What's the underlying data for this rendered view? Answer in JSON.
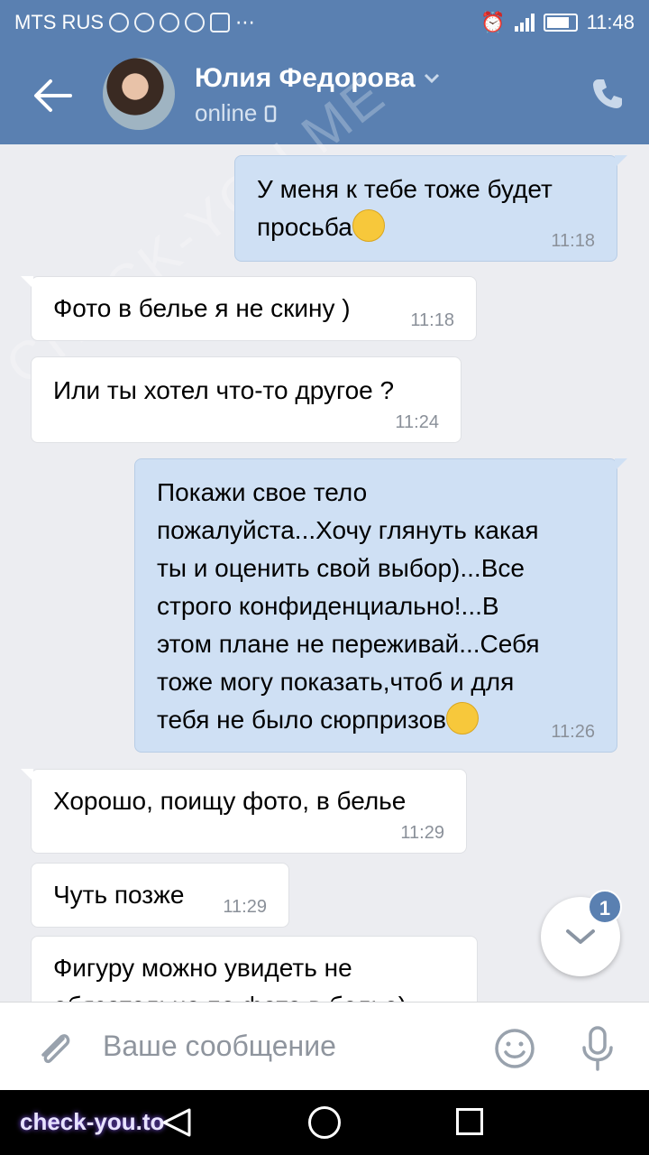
{
  "status_bar": {
    "carrier": "MTS RUS",
    "time": "11:48"
  },
  "header": {
    "contact_name": "Юлия Федорова",
    "presence": "online"
  },
  "messages": [
    {
      "dir": "out",
      "lines": [
        "У меня к тебе тоже будет",
        "просьба"
      ],
      "emoji": "eye-roll",
      "time": "11:18"
    },
    {
      "dir": "in",
      "lines": [
        "Фото в белье я не скину )"
      ],
      "time": "11:18"
    },
    {
      "dir": "in",
      "lines": [
        "Или ты хотел что-то другое ?"
      ],
      "time": "11:24"
    },
    {
      "dir": "out",
      "lines": [
        "Покажи свое тело",
        "пожалуйста...Хочу глянуть какая",
        "ты и оценить свой выбор)...Все",
        "строго конфиденциально!...В",
        "этом плане не переживай...Себя",
        "тоже могу показать,чтоб и для",
        "тебя не было сюрпризов"
      ],
      "emoji": "smile",
      "time": "11:26"
    },
    {
      "dir": "in",
      "lines": [
        "Хорошо, поищу фото, в белье"
      ],
      "time": "11:29"
    },
    {
      "dir": "in",
      "lines": [
        "Чуть позже"
      ],
      "time": "11:29"
    },
    {
      "dir": "in",
      "lines": [
        "Фигуру можно увидеть не",
        "обязательно по фото в белье)"
      ]
    }
  ],
  "scroll_badge_count": "1",
  "composer": {
    "placeholder": "Ваше сообщение"
  },
  "watermark": {
    "bottom": "check-you.to",
    "diagonal": "CHECK-YOU.ME"
  },
  "colors": {
    "header": "#5a80b1",
    "outgoing": "#cfe0f4",
    "incoming": "#ffffff",
    "background": "#ecedf1"
  }
}
